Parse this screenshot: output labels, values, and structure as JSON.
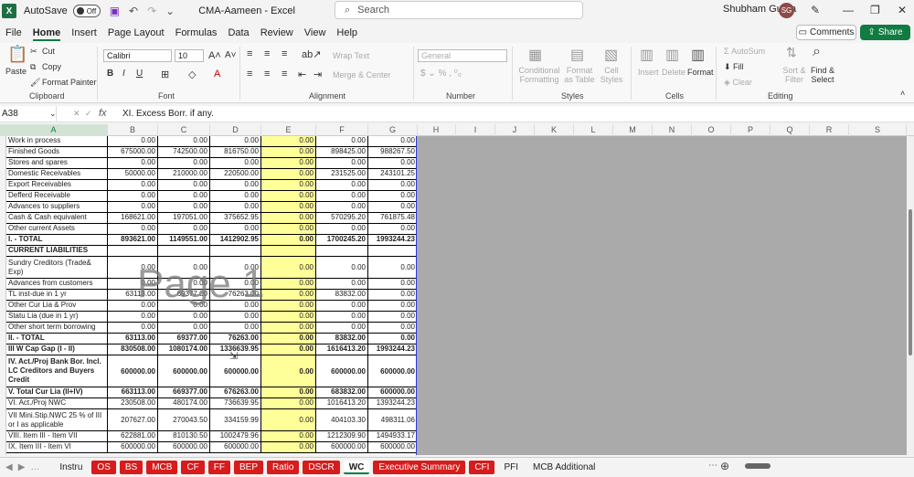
{
  "titlebar": {
    "autosave_label": "AutoSave",
    "autosave_state": "Off",
    "doc_title": "CMA-Aameen  -  Excel",
    "search_placeholder": "Search",
    "user_name": "Shubham Gupta",
    "user_initials": "SG",
    "minimize": "—",
    "restore": "❐",
    "close": "✕"
  },
  "menu": [
    "File",
    "Home",
    "Insert",
    "Page Layout",
    "Formulas",
    "Data",
    "Review",
    "View",
    "Help"
  ],
  "actions": {
    "comments": "Comments",
    "share": "Share"
  },
  "ribbon": {
    "clipboard": {
      "label": "Clipboard",
      "paste": "Paste",
      "cut": "Cut",
      "copy": "Copy",
      "format_painter": "Format Painter"
    },
    "font": {
      "label": "Font",
      "font_name": "Calibri",
      "font_size": "10"
    },
    "alignment": {
      "label": "Alignment",
      "wrap_text": "Wrap Text",
      "merge_center": "Merge & Center"
    },
    "number": {
      "label": "Number",
      "format": "General"
    },
    "styles": {
      "label": "Styles",
      "conditional": "Conditional Formatting",
      "format_as_table": "Format as Table",
      "cell_styles": "Cell Styles"
    },
    "cells": {
      "label": "Cells",
      "insert": "Insert",
      "delete": "Delete",
      "format": "Format"
    },
    "editing": {
      "label": "Editing",
      "autosum": "AutoSum",
      "fill": "Fill",
      "clear": "Clear",
      "sort_filter": "Sort & Filter",
      "find_select": "Find & Select"
    }
  },
  "formula_bar": {
    "name_box": "A38",
    "fx": "fx",
    "content": "XI.  Excess Borr. if any."
  },
  "columns": [
    "A",
    "B",
    "C",
    "D",
    "E",
    "F",
    "G",
    "H",
    "I",
    "J",
    "K",
    "L",
    "M",
    "N",
    "O",
    "P",
    "Q",
    "R",
    "S"
  ],
  "rows": [
    {
      "label": "Work in process",
      "b": "0.00",
      "c": "0.00",
      "d": "0.00",
      "e": "0.00",
      "f": "0.00",
      "g": "0.00"
    },
    {
      "label": "Finished Goods",
      "b": "675000.00",
      "c": "742500.00",
      "d": "816750.00",
      "e": "0.00",
      "f": "898425.00",
      "g": "988267.50"
    },
    {
      "label": "Stores and spares",
      "b": "0.00",
      "c": "0.00",
      "d": "0.00",
      "e": "0.00",
      "f": "0.00",
      "g": "0.00"
    },
    {
      "label": "Domestic Receivables",
      "b": "50000.00",
      "c": "210000.00",
      "d": "220500.00",
      "e": "0.00",
      "f": "231525.00",
      "g": "243101.25"
    },
    {
      "label": "Export Receivables",
      "b": "0.00",
      "c": "0.00",
      "d": "0.00",
      "e": "0.00",
      "f": "0.00",
      "g": "0.00"
    },
    {
      "label": "Defferd Receivable",
      "b": "0.00",
      "c": "0.00",
      "d": "0.00",
      "e": "0.00",
      "f": "0.00",
      "g": "0.00"
    },
    {
      "label": "Advances to suppliers",
      "b": "0.00",
      "c": "0.00",
      "d": "0.00",
      "e": "0.00",
      "f": "0.00",
      "g": "0.00"
    },
    {
      "label": "Cash & Cash equivalent",
      "b": "168621.00",
      "c": "197051.00",
      "d": "375652.95",
      "e": "0.00",
      "f": "570295.20",
      "g": "761875.48"
    },
    {
      "label": "Other current Assets",
      "b": "0.00",
      "c": "0.00",
      "d": "0.00",
      "e": "0.00",
      "f": "0.00",
      "g": "0.00"
    },
    {
      "label": "I.     -     TOTAL",
      "b": "893621.00",
      "c": "1149551.00",
      "d": "1412902.95",
      "e": "0.00",
      "f": "1700245.20",
      "g": "1993244.23",
      "bold": true
    },
    {
      "label": "CURRENT LIABILITIES",
      "b": "",
      "c": "",
      "d": "",
      "e": "",
      "f": "",
      "g": "",
      "bold": true
    },
    {
      "label": "Sundry Creditors (Trade& Exp)",
      "b": "0.00",
      "c": "0.00",
      "d": "0.00",
      "e": "0.00",
      "f": "0.00",
      "g": "0.00",
      "tall": true
    },
    {
      "label": "Advances from customers",
      "b": "0.00",
      "c": "0.00",
      "d": "0.00",
      "e": "0.00",
      "f": "0.00",
      "g": "0.00"
    },
    {
      "label": "TL inst-due in 1 yr",
      "b": "63113.00",
      "c": "69377.00",
      "d": "76263.00",
      "e": "0.00",
      "f": "83832.00",
      "g": "0.00"
    },
    {
      "label": "Other Cur Lia & Prov",
      "b": "0.00",
      "c": "0.00",
      "d": "0.00",
      "e": "0.00",
      "f": "0.00",
      "g": "0.00"
    },
    {
      "label": "Statu Lia (due in 1 yr)",
      "b": "0.00",
      "c": "0.00",
      "d": "0.00",
      "e": "0.00",
      "f": "0.00",
      "g": "0.00"
    },
    {
      "label": "Other short term borrowing",
      "b": "0.00",
      "c": "0.00",
      "d": "0.00",
      "e": "0.00",
      "f": "0.00",
      "g": "0.00"
    },
    {
      "label": "II.     -     TOTAL",
      "b": "63113.00",
      "c": "69377.00",
      "d": "76263.00",
      "e": "0.00",
      "f": "83832.00",
      "g": "0.00",
      "bold": true
    },
    {
      "label": "III W Cap Gap (I - II)",
      "b": "830508.00",
      "c": "1080174.00",
      "d": "1336639.95",
      "e": "0.00",
      "f": "1616413.20",
      "g": "1993244.23",
      "bold": true
    },
    {
      "label": "IV.  Act./Proj Bank Bor. Incl. LC Creditors and Buyers Credit",
      "b": "600000.00",
      "c": "600000.00",
      "d": "600000.00",
      "e": "0.00",
      "f": "600000.00",
      "g": "600000.00",
      "bold": true,
      "tall3": true
    },
    {
      "label": "V.  Total Cur Lia (II+IV)",
      "b": "663113.00",
      "c": "669377.00",
      "d": "676263.00",
      "e": "0.00",
      "f": "683832.00",
      "g": "600000.00",
      "bold": true
    },
    {
      "label": "VI.  Act./Proj NWC",
      "b": "230508.00",
      "c": "480174.00",
      "d": "736639.95",
      "e": "0.00",
      "f": "1016413.20",
      "g": "1393244.23"
    },
    {
      "label": "VII  Mini.Stip.NWC 25 % of III or I as applicable",
      "b": "207627.00",
      "c": "270043.50",
      "d": "334159.99",
      "e": "0.00",
      "f": "404103.30",
      "g": "498311.06",
      "tall": true
    },
    {
      "label": "VIII.  Item III - Item VII",
      "b": "622881.00",
      "c": "810130.50",
      "d": "1002479.96",
      "e": "0.00",
      "f": "1212309.90",
      "g": "1494933.17"
    },
    {
      "label": "IX.  Item III - Item VI",
      "b": "600000.00",
      "c": "600000.00",
      "d": "600000.00",
      "e": "0.00",
      "f": "600000.00",
      "g": "600000.00"
    }
  ],
  "watermark": "Page 1",
  "tabs": [
    {
      "name": "Instru",
      "style": "plain"
    },
    {
      "name": "OS",
      "style": "red"
    },
    {
      "name": "BS",
      "style": "red"
    },
    {
      "name": "MCB",
      "style": "red"
    },
    {
      "name": "CF",
      "style": "red"
    },
    {
      "name": "FF",
      "style": "red"
    },
    {
      "name": "BEP",
      "style": "red"
    },
    {
      "name": "Ratio",
      "style": "red"
    },
    {
      "name": "DSCR",
      "style": "red"
    },
    {
      "name": "WC",
      "style": "active"
    },
    {
      "name": "Executive Summary",
      "style": "red"
    },
    {
      "name": "CFI",
      "style": "red"
    },
    {
      "name": "PFI",
      "style": "plain"
    },
    {
      "name": "MCB Additional",
      "style": "plain"
    }
  ]
}
